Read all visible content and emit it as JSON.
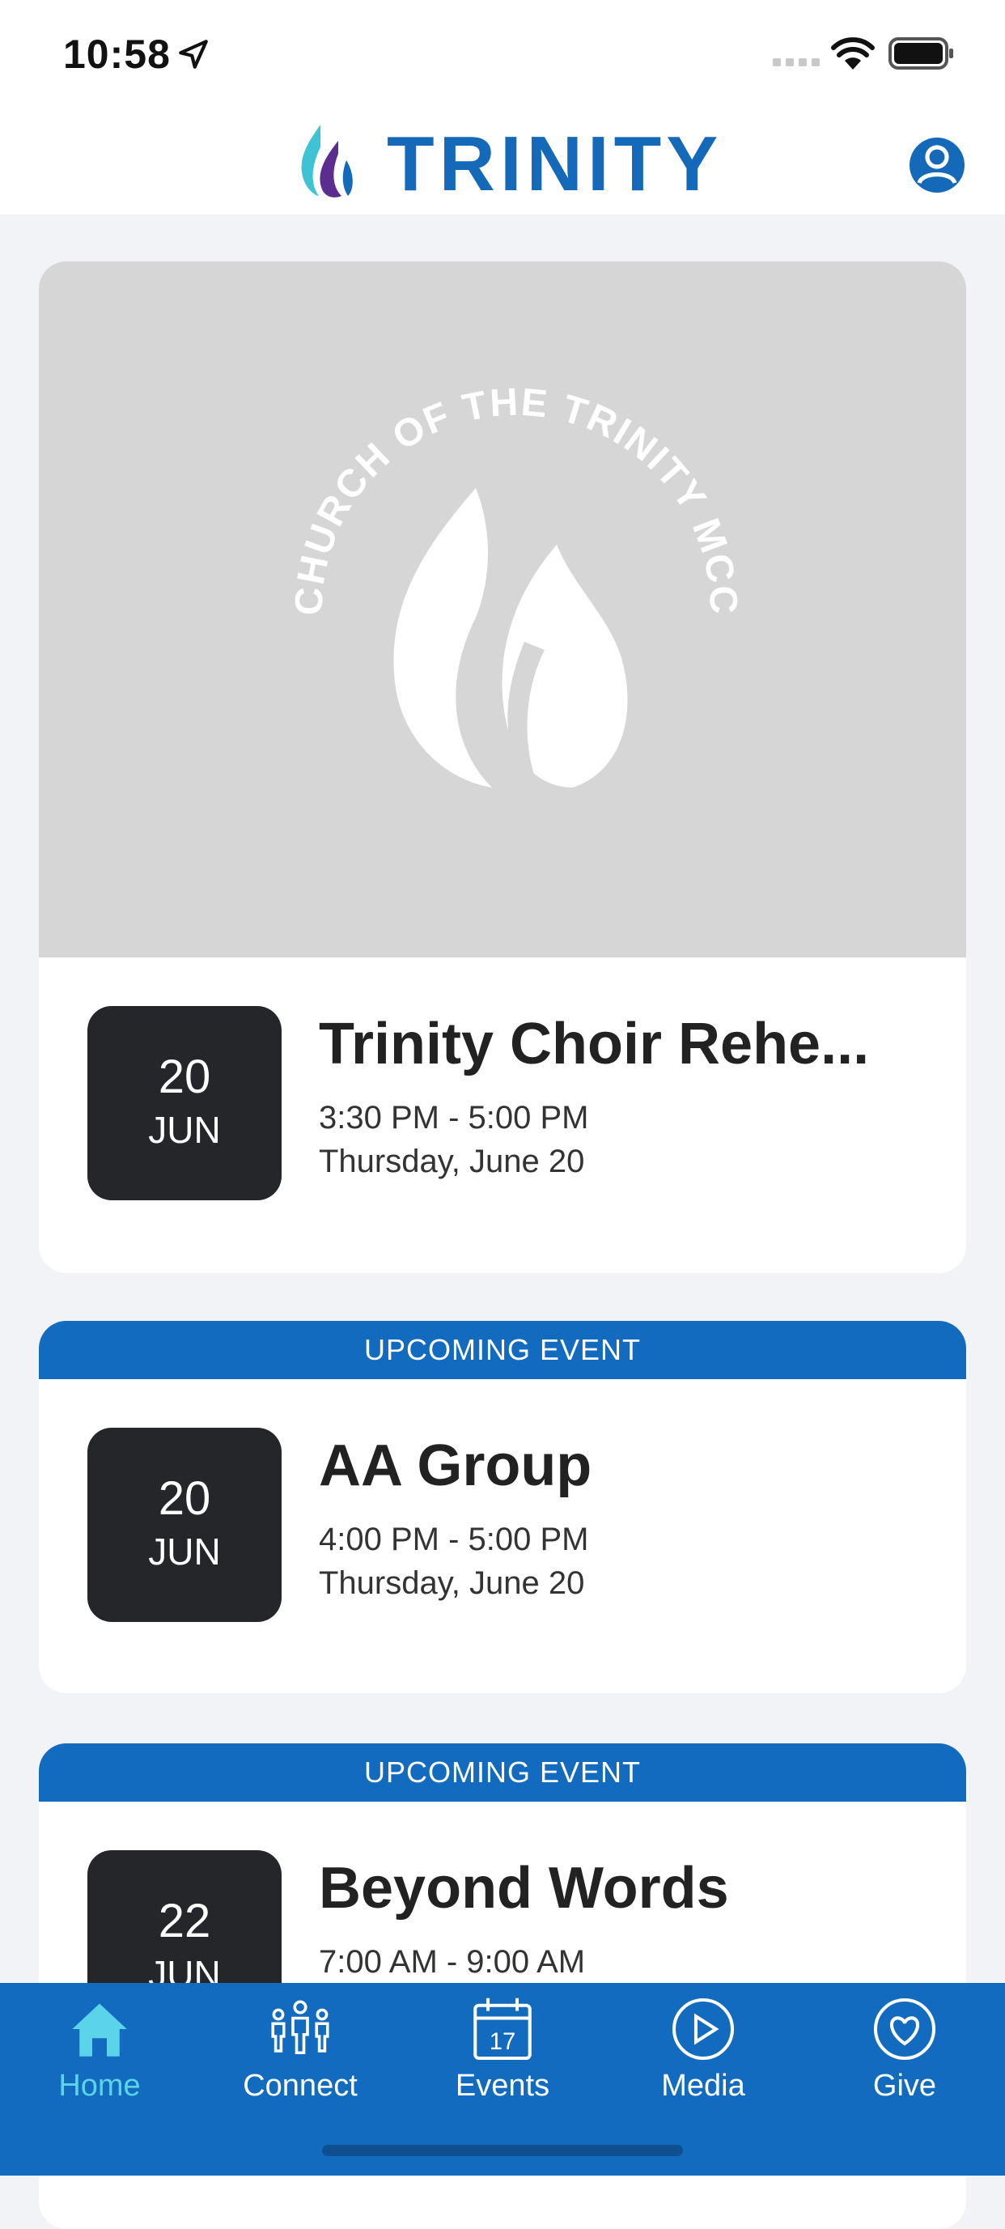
{
  "status_bar": {
    "time": "10:58",
    "icons": [
      "location-arrow-icon",
      "signal-icon",
      "wifi-icon",
      "battery-icon"
    ]
  },
  "header": {
    "app_name": "TRINITY",
    "logo_icon": "flame-logo-icon",
    "profile_icon": "profile-icon"
  },
  "colors": {
    "brand_blue": "#1469b8",
    "tab_bar_blue": "#136bbf",
    "active_tab": "#5bd3e8",
    "date_box": "#252629",
    "hero_bg": "#d6d6d6"
  },
  "hero": {
    "image_text": "CHURCH OF THE TRINITY MCC"
  },
  "events": [
    {
      "banner": "",
      "day": "20",
      "month": "JUN",
      "title": "Trinity Choir Rehe...",
      "time": "3:30 PM - 5:00 PM",
      "date": "Thursday, June 20"
    },
    {
      "banner": "UPCOMING EVENT",
      "day": "20",
      "month": "JUN",
      "title": "AA Group",
      "time": "4:00 PM - 5:00 PM",
      "date": "Thursday, June 20"
    },
    {
      "banner": "UPCOMING EVENT",
      "day": "22",
      "month": "JUN",
      "title": "Beyond Words",
      "time": "7:00 AM - 9:00 AM",
      "date": ""
    }
  ],
  "tabs": [
    {
      "label": "Home",
      "icon": "home-icon",
      "active": true
    },
    {
      "label": "Connect",
      "icon": "people-icon",
      "active": false
    },
    {
      "label": "Events",
      "icon": "calendar-icon",
      "calendar_number": "17",
      "active": false
    },
    {
      "label": "Media",
      "icon": "play-icon",
      "active": false
    },
    {
      "label": "Give",
      "icon": "heart-icon",
      "active": false
    }
  ]
}
